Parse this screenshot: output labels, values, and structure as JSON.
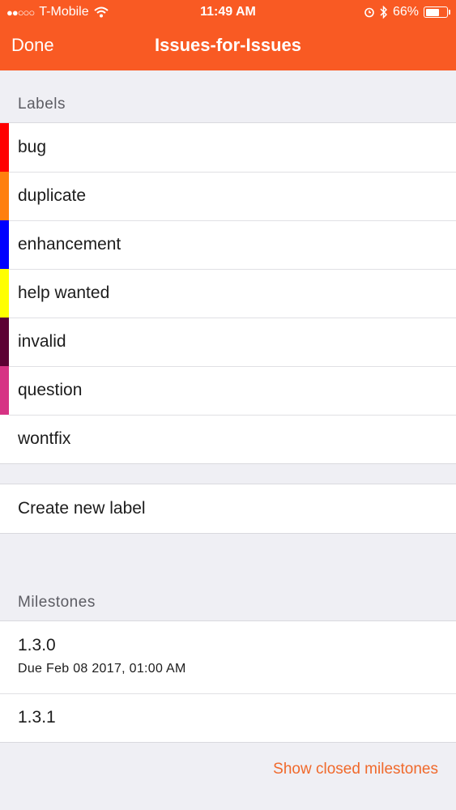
{
  "status_bar": {
    "carrier": "T-Mobile",
    "time": "11:49 AM",
    "battery": "66%",
    "battery_level": 0.66
  },
  "nav": {
    "done_label": "Done",
    "title": "Issues-for-Issues"
  },
  "labels_section": {
    "header": "Labels",
    "items": [
      {
        "name": "bug",
        "color": "#ff0000"
      },
      {
        "name": "duplicate",
        "color": "#ff7f0e"
      },
      {
        "name": "enhancement",
        "color": "#0000ff"
      },
      {
        "name": "help wanted",
        "color": "#ffff00"
      },
      {
        "name": "invalid",
        "color": "#5c0033"
      },
      {
        "name": "question",
        "color": "#d63384"
      },
      {
        "name": "wontfix",
        "color": "#ffffff"
      }
    ]
  },
  "create_label": "Create new label",
  "milestones_section": {
    "header": "Milestones",
    "items": [
      {
        "title": "1.3.0",
        "due": "Due Feb 08 2017, 01:00 AM"
      },
      {
        "title": "1.3.1"
      }
    ],
    "show_closed_label": "Show closed milestones"
  },
  "colors": {
    "accent": "#f95a23",
    "link": "#f0692b"
  }
}
